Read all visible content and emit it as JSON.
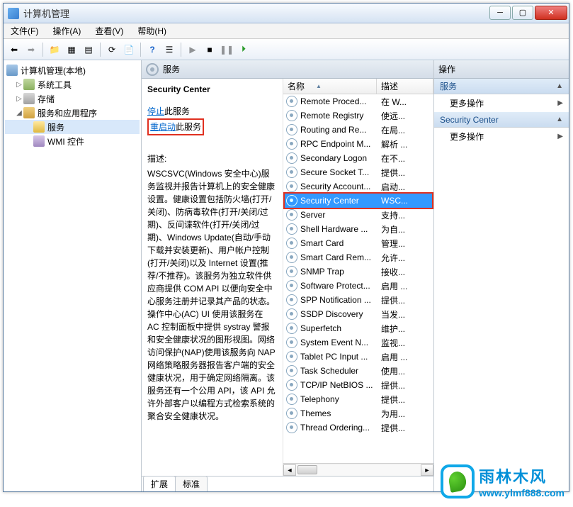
{
  "window": {
    "title": "计算机管理"
  },
  "menubar": [
    "文件(F)",
    "操作(A)",
    "查看(V)",
    "帮助(H)"
  ],
  "tree": {
    "root": "计算机管理(本地)",
    "items": [
      {
        "label": "系统工具",
        "expand": "▷"
      },
      {
        "label": "存储",
        "expand": "▷"
      },
      {
        "label": "服务和应用程序",
        "expand": "◢"
      }
    ],
    "sub": [
      {
        "label": "服务"
      },
      {
        "label": "WMI 控件"
      }
    ]
  },
  "services_header": "服务",
  "detail": {
    "name": "Security Center",
    "stop_link": "停止",
    "stop_suffix": "此服务",
    "restart_link": "重启动",
    "restart_suffix": "此服务",
    "desc_label": "描述:",
    "desc_text": "WSCSVC(Windows 安全中心)服务监视并报告计算机上的安全健康设置。健康设置包括防火墙(打开/关闭)、防病毒软件(打开/关闭/过期)、反间谍软件(打开/关闭/过期)、Windows Update(自动/手动下载并安装更新)、用户帐户控制(打开/关闭)以及 Internet 设置(推荐/不推荐)。该服务为独立软件供应商提供 COM API 以便向安全中心服务注册并记录其产品的状态。操作中心(AC) UI 使用该服务在 AC 控制面板中提供 systray 警报和安全健康状况的图形视图。网络访问保护(NAP)使用该服务向 NAP 网络策略服务器报告客户端的安全健康状况，用于确定网络隔离。该服务还有一个公用 API，该 API 允许外部客户以编程方式检索系统的聚合安全健康状况。"
  },
  "list": {
    "cols": {
      "name": "名称",
      "desc": "描述"
    },
    "rows": [
      {
        "name": "Remote Proced...",
        "desc": "在 W..."
      },
      {
        "name": "Remote Registry",
        "desc": "使远..."
      },
      {
        "name": "Routing and Re...",
        "desc": "在局..."
      },
      {
        "name": "RPC Endpoint M...",
        "desc": "解析 ..."
      },
      {
        "name": "Secondary Logon",
        "desc": "在不..."
      },
      {
        "name": "Secure Socket T...",
        "desc": "提供..."
      },
      {
        "name": "Security Account...",
        "desc": "启动..."
      },
      {
        "name": "Security Center",
        "desc": "WSC...",
        "selected": true
      },
      {
        "name": "Server",
        "desc": "支持..."
      },
      {
        "name": "Shell Hardware ...",
        "desc": "为自..."
      },
      {
        "name": "Smart Card",
        "desc": "管理..."
      },
      {
        "name": "Smart Card Rem...",
        "desc": "允许..."
      },
      {
        "name": "SNMP Trap",
        "desc": "接收..."
      },
      {
        "name": "Software Protect...",
        "desc": "启用 ..."
      },
      {
        "name": "SPP Notification ...",
        "desc": "提供..."
      },
      {
        "name": "SSDP Discovery",
        "desc": "当发..."
      },
      {
        "name": "Superfetch",
        "desc": "维护..."
      },
      {
        "name": "System Event N...",
        "desc": "监视..."
      },
      {
        "name": "Tablet PC Input ...",
        "desc": "启用 ..."
      },
      {
        "name": "Task Scheduler",
        "desc": "使用..."
      },
      {
        "name": "TCP/IP NetBIOS ...",
        "desc": "提供..."
      },
      {
        "name": "Telephony",
        "desc": "提供..."
      },
      {
        "name": "Themes",
        "desc": "为用..."
      },
      {
        "name": "Thread Ordering...",
        "desc": "提供..."
      }
    ]
  },
  "tabs": {
    "extended": "扩展",
    "standard": "标准"
  },
  "actions": {
    "header": "操作",
    "services": "服务",
    "more": "更多操作",
    "selected": "Security Center"
  },
  "watermark": {
    "cn": "雨林木风",
    "url": "www.ylmf888.com"
  }
}
